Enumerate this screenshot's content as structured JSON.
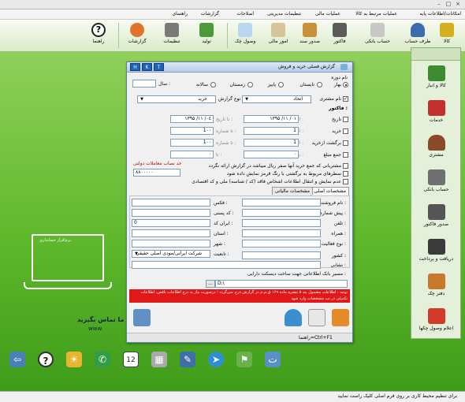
{
  "menu": {
    "items": [
      "امکانات/اطلاعات پایه",
      "عملیات مرتبط به کالا",
      "عملیات مالی",
      "تنظیمات مدیریتی",
      "اصلاحات",
      "گزارشات",
      "راهنمای"
    ]
  },
  "toolbar": {
    "kala": "کالا",
    "taraf_hesab": "طرف حساب",
    "hesab_banki": "حساب بانکی",
    "factor": "فاکتور",
    "sodur_sanad": "صدور سند",
    "omur_mali": "امور مالی",
    "vosul_check": "وصول چک",
    "tolid": "تولید",
    "tanzimat": "تنظیمات",
    "gozareshat": "گزارشات",
    "rahnama": "راهنما"
  },
  "right_panel": {
    "items": [
      "کالا و انبار",
      "خدمات",
      "مشتری",
      "حساب بانکی",
      "صدور فاکتور",
      "دریافت و پرداخت",
      "دفتر چک",
      "اعلام وصول چکها"
    ]
  },
  "desktop": {
    "laptop_brand": "نرم‌افزار حسابداری",
    "contact_line": "با ما تماس بگیرید",
    "contact_line2": "www."
  },
  "dialog": {
    "title": "گزارش فصلی خرید و فروش",
    "hotkeys": [
      "H",
      "K",
      "T"
    ],
    "period_label": "نام دوره",
    "seasons": [
      "بهار",
      "تابستان",
      "پاییز",
      "زمستان",
      "سالانه"
    ],
    "year_label": "سال :",
    "customer_name_label": "نام مشتری",
    "customer_value": "اتحاد",
    "report_type_label": "نوع گزارش",
    "report_type_value": "خرید",
    "invoice_label": "فاکتور :",
    "rows": [
      {
        "label": "تاریخ",
        "from_label": "از تاریخ :",
        "from_value": "۱۳۹۵ /۱۱ /۰۱",
        "to_label": "تا تاریخ :",
        "to_value": "۱۳۹۵ /۱۱ /۰٤"
      },
      {
        "label": "خرید",
        "from_label": "از شماره :",
        "from_value": "1",
        "to_label": "تا شماره :",
        "to_value": "1۰۰"
      },
      {
        "label": "برگشت ازخرید",
        "from_label": "از شماره :",
        "from_value": "1",
        "to_label": "تا شماره :",
        "to_value": "1۰۰"
      },
      {
        "label": "جمع مبلغ",
        "from_label": "بین :",
        "from_value": "۰",
        "to_label": "تا :",
        "to_value": "۰"
      }
    ],
    "limit_label": "حد نصاب معاملات دولتی",
    "limit_value": "۸۸۰۰۰۰۰",
    "options": [
      "مشتریانی که جمع خرید آنها صفر ریال میباشد در گزارش ارائه نگردد",
      "سطرهای مربوط به برگشتی با رنگ قرمز نمایش داده شود",
      "عدم نمایش و انتقال اطلاعات اشخاص فاقد (کد / شناسه) ملی و کد اقتصادی"
    ],
    "tabs": [
      "مشخصات اصلی",
      "مشخصات مالیاتی"
    ],
    "fields_right": [
      "نام فروشنده :",
      "پیش شماره :",
      "تلفن :",
      "همراه :",
      "نوع فعالیت :",
      "کشور :",
      "نشانی :"
    ],
    "fields_left": [
      "فکس :",
      "کد پستی :",
      "ایران کد :",
      "استان :",
      "شهر :",
      "تابعیت :"
    ],
    "iran_code_value": "0",
    "nationality_value": "شرکت ایرانی/مودی اصلی حقیقی",
    "path_label": "مسیر بانک اطلاعاتی جهت ساخت دیسکت دارایی :",
    "path_value": "D:\\",
    "browse_label": "...",
    "warning_text": "توجه : اطلاعات مشمول بند ۵ تبصره ماده ۱۶۹ ق.م.م در گزارش درج نمی‌گردد ؛ درصورت نیاز به درج اطلاعات ناقص، اطلاعات تکمیلی در تب مشخصات وارد شود",
    "status_text": "راهنما=Ctrl+F1"
  },
  "status_bar": {
    "text": "برای تنظیم محیط کاری بر روی فرم اصلی کلیک راست نمایید"
  },
  "dock": {
    "calendar_day": "12"
  },
  "colors": {
    "desktop_green": "#5fb82c",
    "warning_red": "#e01818",
    "hotkey_blue": "#1e63b8"
  }
}
